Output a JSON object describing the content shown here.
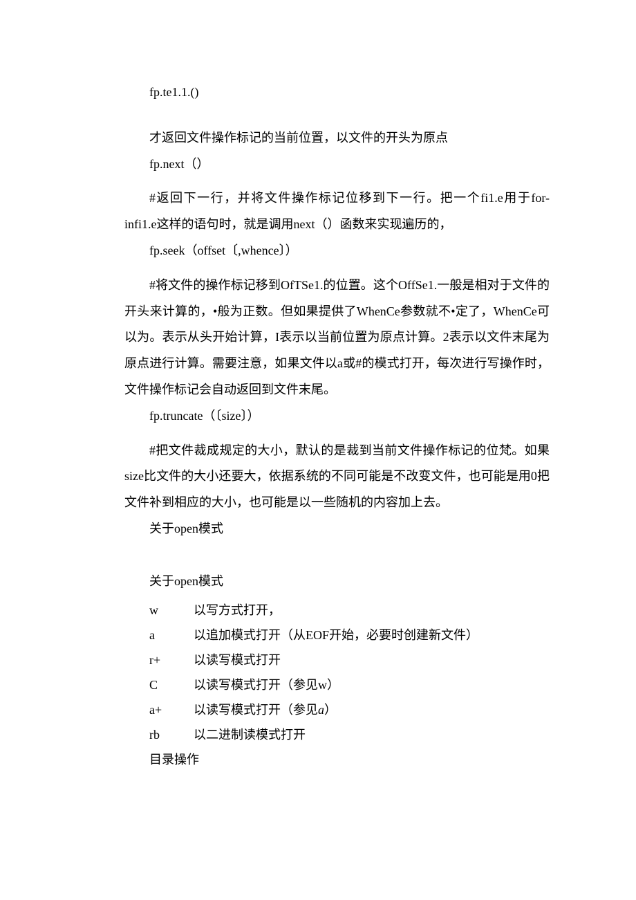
{
  "lines": {
    "l1": "fp.te1.1.()",
    "l2": "才返回文件操作标记的当前位置，以文件的开头为原点",
    "l3": "fp.next（）",
    "l4": "#返回下一行，并将文件操作标记位移到下一行。把一个fi1.e用于for-infi1.e这样的语句时，就是调用next（）函数来实现遍历的，",
    "l5": "fp.seek（offset〔,whence〕）",
    "l6": "#将文件的操作标记移到OfTSe1.的位置。这个OffSe1.一般是相对于文件的开头来计算的，•般为正数。但如果提供了WhenCe参数就不•定了，WhenCe可以为。表示从头开始计算，I表示以当前位置为原点计算。2表示以文件末尾为原点进行计算。需要注意，如果文件以a或#的模式打开，每次进行写操作时，文件操作标记会自动返回到文件末尾。",
    "l7": "fp.truncate（〔size〕）",
    "l8": "#把文件裁成规定的大小，默认的是裁到当前文件操作标记的位梵。如果size比文件的大小还要大，依据系统的不同可能是不改变文件，也可能是用0把文件补到相应的大小，也可能是以一些随机的内容加上去。",
    "l9": "关于open模式",
    "l10": "关于open模式",
    "l11": "目录操作"
  },
  "modes": [
    {
      "key": "w",
      "desc": "以写方式打开，"
    },
    {
      "key": "a",
      "desc": "以追加模式打开（从EOF开始，必要时创建新文件）"
    },
    {
      "key": "r+",
      "desc": "以读写模式打开"
    },
    {
      "key": "C",
      "desc": "以读写模式打开（参见w）"
    },
    {
      "key": "a+",
      "desc_prefix": "以读写模式打开（参见",
      "desc_em": "a",
      "desc_suffix": "）"
    },
    {
      "key": "rb",
      "desc": "以二进制读模式打开"
    }
  ]
}
